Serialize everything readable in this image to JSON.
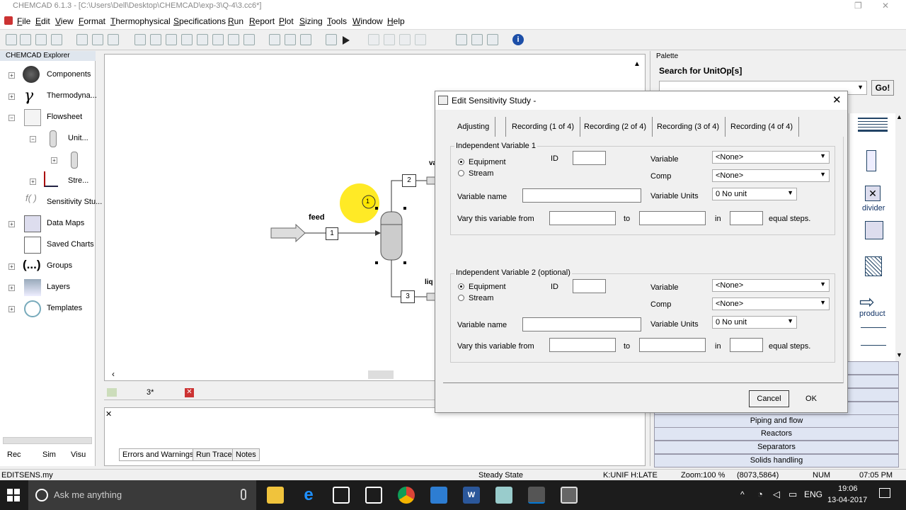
{
  "window": {
    "title": "CHEMCAD 6.1.3 - [C:\\Users\\Dell\\Desktop\\CHEMCAD\\exp-3\\Q-4\\3.cc6*]"
  },
  "menu": [
    "File",
    "Edit",
    "View",
    "Format",
    "Thermophysical",
    "Specifications",
    "Run",
    "Report",
    "Plot",
    "Sizing",
    "Tools",
    "Window",
    "Help"
  ],
  "explorer": {
    "title": "CHEMCAD Explorer",
    "items": [
      "Components",
      "Thermodyna...",
      "Flowsheet",
      "Unit...",
      "Stre...",
      "Sensitivity Stu...",
      "Data Maps",
      "Saved Charts",
      "Groups",
      "Layers",
      "Templates"
    ],
    "bottom_tabs": [
      "Rec",
      "Sim",
      "Visu"
    ]
  },
  "flowsheet": {
    "feed_label": "feed",
    "stream_ids": [
      "1",
      "2",
      "3"
    ],
    "unit_id": "1",
    "partial_labels": [
      "va",
      "liq"
    ],
    "tab_label": "3*"
  },
  "log": {
    "tabs": [
      "Errors and Warnings",
      "Run Trace",
      "Notes"
    ]
  },
  "palette": {
    "title": "Palette",
    "search_label": "Search for UnitOp[s]",
    "go_label": "Go!",
    "item_labels": [
      "divider",
      "product"
    ],
    "categories": [
      "Piping and flow",
      "Reactors",
      "Separators",
      "Solids handling"
    ]
  },
  "dialog": {
    "title": "Edit Sensitivity Study -",
    "tabs": [
      "Adjusting",
      "Recording (1 of 4)",
      "Recording (2 of 4)",
      "Recording (3 of 4)",
      "Recording (4 of 4)"
    ],
    "group1": {
      "label": "Independent Variable 1",
      "radio_equipment": "Equipment",
      "radio_stream": "Stream",
      "id_label": "ID",
      "variable_label": "Variable",
      "variable_value": "<None>",
      "comp_label": "Comp",
      "comp_value": "<None>",
      "variable_name_label": "Variable name",
      "variable_units_label": "Variable Units",
      "variable_units_value": "0 No unit",
      "vary_label": "Vary this variable from",
      "to_label": "to",
      "in_label": "in",
      "equal_steps_label": "equal steps."
    },
    "group2": {
      "label": "Independent Variable 2 (optional)",
      "radio_equipment": "Equipment",
      "radio_stream": "Stream",
      "id_label": "ID",
      "variable_label": "Variable",
      "variable_value": "<None>",
      "comp_label": "Comp",
      "comp_value": "<None>",
      "variable_name_label": "Variable name",
      "variable_units_label": "Variable Units",
      "variable_units_value": "0 No unit",
      "vary_label": "Vary this variable from",
      "to_label": "to",
      "in_label": "in",
      "equal_steps_label": "equal steps."
    },
    "cancel_label": "Cancel",
    "ok_label": "OK"
  },
  "statusbar": {
    "file": "EDITSENS.my",
    "state": "Steady State",
    "thermo": "K:UNIF H:LATE",
    "zoom": "Zoom:100 %",
    "coords": "(8073,5864)",
    "num": "NUM",
    "time": "07:05 PM"
  },
  "taskbar": {
    "search_placeholder": "Ask me anything",
    "lang": "ENG",
    "clock_time": "19:06",
    "clock_date": "13-04-2017"
  },
  "colors": {
    "accent": "#0078d7",
    "highlight": "#ffe600",
    "taskbar": "#1c1c1c"
  }
}
